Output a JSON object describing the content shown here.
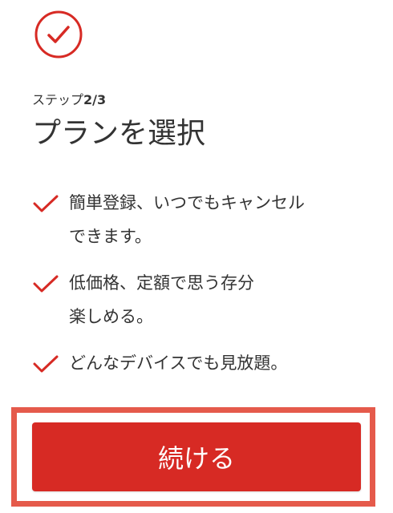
{
  "header": {
    "check_icon": "check-circle-icon",
    "accent_color": "#d72a24"
  },
  "step": {
    "prefix": "ステップ",
    "number": "2/3"
  },
  "title": "プランを選択",
  "benefits": [
    {
      "line1": "簡単登録、いつでもキャンセル",
      "line2": "できます。"
    },
    {
      "line1": "低価格、定額で思う存分",
      "line2": "楽しめる。"
    },
    {
      "line1": "どんなデバイスでも見放題。",
      "line2": ""
    }
  ],
  "continue_button": {
    "label": "続ける",
    "color": "#d72a24"
  }
}
